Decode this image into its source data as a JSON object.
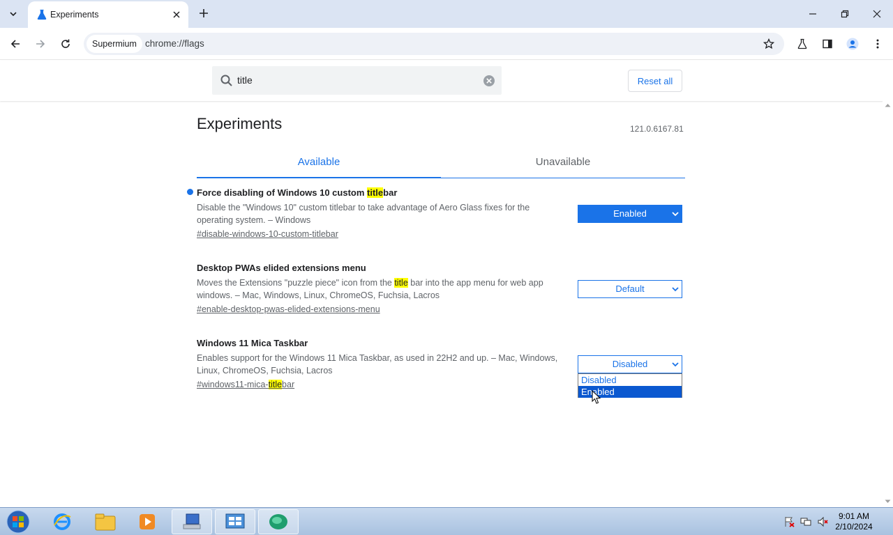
{
  "browser": {
    "tab_title": "Experiments",
    "site_chip": "Supermium",
    "url": "chrome://flags"
  },
  "flags_header": {
    "search_value": "title",
    "reset_label": "Reset all"
  },
  "page": {
    "title": "Experiments",
    "version": "121.0.6167.81",
    "tabs": [
      {
        "label": "Available",
        "active": true
      },
      {
        "label": "Unavailable",
        "active": false
      }
    ]
  },
  "flags": [
    {
      "title_pre": "Force disabling of Windows 10 custom ",
      "title_hl": "title",
      "title_post": "bar",
      "desc": "Disable the \"Windows 10\" custom titlebar to take advantage of Aero Glass fixes for the operating system. – Windows",
      "link": "#disable-windows-10-custom-titlebar",
      "value": "Enabled"
    },
    {
      "title": "Desktop PWAs elided extensions menu",
      "desc_pre": "Moves the Extensions \"puzzle piece\" icon from the ",
      "desc_hl": "title",
      "desc_post": " bar into the app menu for web app windows. – Mac, Windows, Linux, ChromeOS, Fuchsia, Lacros",
      "link": "#enable-desktop-pwas-elided-extensions-menu",
      "value": "Default"
    },
    {
      "title": "Windows 11 Mica Taskbar",
      "desc": "Enables support for the Windows 11 Mica Taskbar, as used in 22H2 and up. – Mac, Windows, Linux, ChromeOS, Fuchsia, Lacros",
      "link_pre": "#windows11-mica-",
      "link_hl": "title",
      "link_post": "bar",
      "value": "Disabled",
      "options": [
        "Disabled",
        "Enabled"
      ]
    }
  ],
  "taskbar": {
    "time": "9:01 AM",
    "date": "2/10/2024"
  },
  "colors": {
    "accent": "#1a73e8",
    "highlight": "#ffff00",
    "tabstrip": "#dbe4f3"
  }
}
